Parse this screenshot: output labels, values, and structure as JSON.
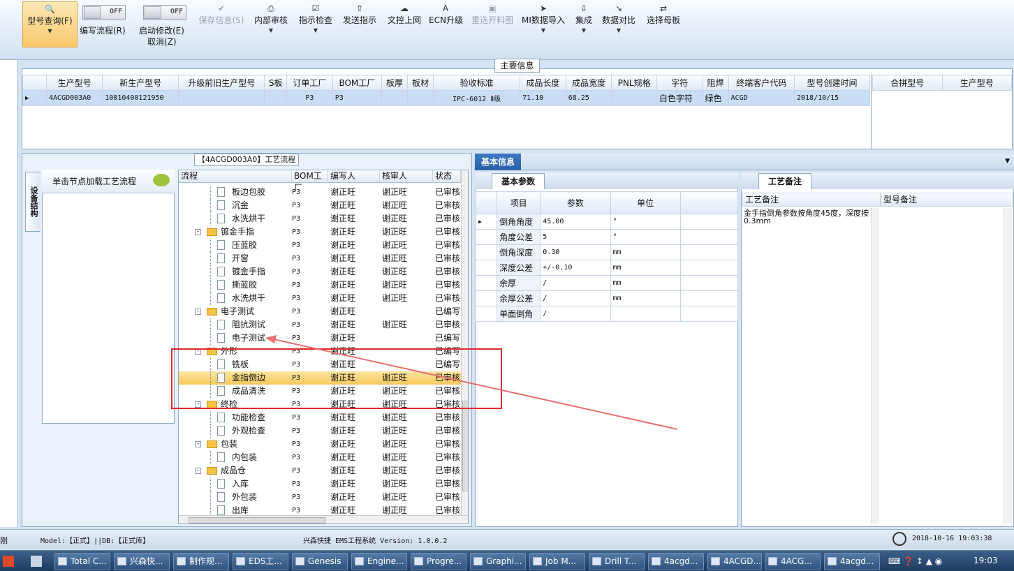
{
  "toolbar": {
    "query": {
      "label": "型号查询(F)",
      "icon": "search-icon"
    },
    "write_flow": {
      "label": "编写流程(R)",
      "toggle": "OFF"
    },
    "start_modify": {
      "label": "启动修改(E)",
      "label2": "取消(Z)",
      "toggle": "OFF"
    },
    "save_info": "保存信息(S)",
    "internal_review": "内部审核",
    "check_instr": "指示检查",
    "send_instr": "发送指示",
    "doc_online": "文控上网",
    "ecn_upgrade": "ECN升级",
    "reopen_drawing": "重选开料图",
    "mi_import": "MI数据导入",
    "integrate": "集成",
    "data_compare": "数据对比",
    "select_master": "选择母板"
  },
  "main_info": {
    "title": "主要信息",
    "headers": [
      "生产型号",
      "新生产型号",
      "升级前旧生产型号",
      "S板",
      "订单工厂",
      "BOM工厂",
      "板厚",
      "板材",
      "验收标准",
      "成品长度",
      "成品宽度",
      "PNL规格",
      "字符",
      "阻焊",
      "终端客户代码",
      "型号创建时间"
    ],
    "row": [
      "4ACGD003A0",
      "10010400121950",
      "",
      "",
      "P3",
      "P3",
      "",
      "",
      "IPC-6012 Ⅱ级",
      "71.10",
      "68.25",
      "",
      "白色字符",
      "绿色",
      "ACGD",
      "2018/10/15"
    ],
    "side_headers": [
      "合拼型号",
      "生产型号"
    ]
  },
  "flow": {
    "title": "【4ACGD003A0】工艺流程",
    "side_tab": "设备结构",
    "hint": "单击节点加载工艺流程",
    "headers": [
      "流程",
      "BOM工厂",
      "编写人",
      "核审人",
      "状态"
    ],
    "rows": [
      {
        "name": "板边包胶",
        "type": "doc",
        "bom": "P3",
        "writer": "谢正旺",
        "reviewer": "谢正旺",
        "status": "已审核"
      },
      {
        "name": "沉金",
        "type": "doc",
        "bom": "P3",
        "writer": "谢正旺",
        "reviewer": "谢正旺",
        "status": "已审核"
      },
      {
        "name": "水洗烘干",
        "type": "doc",
        "bom": "P3",
        "writer": "谢正旺",
        "reviewer": "谢正旺",
        "status": "已审核"
      },
      {
        "name": "镀金手指",
        "type": "folder",
        "bom": "P3",
        "writer": "谢正旺",
        "reviewer": "谢正旺",
        "status": "已审核"
      },
      {
        "name": "压蓝胶",
        "type": "doc",
        "bom": "P3",
        "writer": "谢正旺",
        "reviewer": "谢正旺",
        "status": "已审核"
      },
      {
        "name": "开窗",
        "type": "doc",
        "bom": "P3",
        "writer": "谢正旺",
        "reviewer": "谢正旺",
        "status": "已审核"
      },
      {
        "name": "镀金手指",
        "type": "doc",
        "bom": "P3",
        "writer": "谢正旺",
        "reviewer": "谢正旺",
        "status": "已审核"
      },
      {
        "name": "撕蓝胶",
        "type": "doc",
        "bom": "P3",
        "writer": "谢正旺",
        "reviewer": "谢正旺",
        "status": "已审核"
      },
      {
        "name": "水洗烘干",
        "type": "doc",
        "bom": "P3",
        "writer": "谢正旺",
        "reviewer": "谢正旺",
        "status": "已审核"
      },
      {
        "name": "电子测试",
        "type": "folder",
        "bom": "P3",
        "writer": "谢正旺",
        "reviewer": "",
        "status": "已编写"
      },
      {
        "name": "阻抗测试",
        "type": "doc",
        "bom": "P3",
        "writer": "谢正旺",
        "reviewer": "谢正旺",
        "status": "已审核"
      },
      {
        "name": "电子测试",
        "type": "doc",
        "bom": "P3",
        "writer": "谢正旺",
        "reviewer": "",
        "status": "已编写"
      },
      {
        "name": "外形",
        "type": "folder",
        "bom": "P3",
        "writer": "谢正旺",
        "reviewer": "",
        "status": "已编写"
      },
      {
        "name": "铣板",
        "type": "doc",
        "bom": "P3",
        "writer": "谢正旺",
        "reviewer": "",
        "status": "已编写"
      },
      {
        "name": "金指倒边",
        "type": "doc",
        "bom": "P3",
        "writer": "谢正旺",
        "reviewer": "谢正旺",
        "status": "已审核",
        "selected": true
      },
      {
        "name": "成品清洗",
        "type": "doc",
        "bom": "P3",
        "writer": "谢正旺",
        "reviewer": "谢正旺",
        "status": "已审核"
      },
      {
        "name": "终检",
        "type": "folder",
        "bom": "P3",
        "writer": "谢正旺",
        "reviewer": "谢正旺",
        "status": "已审核"
      },
      {
        "name": "功能检查",
        "type": "doc",
        "bom": "P3",
        "writer": "谢正旺",
        "reviewer": "谢正旺",
        "status": "已审核"
      },
      {
        "name": "外观检查",
        "type": "doc",
        "bom": "P3",
        "writer": "谢正旺",
        "reviewer": "谢正旺",
        "status": "已审核"
      },
      {
        "name": "包装",
        "type": "folder",
        "bom": "P3",
        "writer": "谢正旺",
        "reviewer": "谢正旺",
        "status": "已审核"
      },
      {
        "name": "内包装",
        "type": "doc",
        "bom": "P3",
        "writer": "谢正旺",
        "reviewer": "谢正旺",
        "status": "已审核"
      },
      {
        "name": "成品仓",
        "type": "folder",
        "bom": "P3",
        "writer": "谢正旺",
        "reviewer": "谢正旺",
        "status": "已审核"
      },
      {
        "name": "入库",
        "type": "doc",
        "bom": "P3",
        "writer": "谢正旺",
        "reviewer": "谢正旺",
        "status": "已审核"
      },
      {
        "name": "外包装",
        "type": "doc",
        "bom": "P3",
        "writer": "谢正旺",
        "reviewer": "谢正旺",
        "status": "已审核"
      },
      {
        "name": "出库",
        "type": "doc",
        "bom": "P3",
        "writer": "谢正旺",
        "reviewer": "谢正旺",
        "status": "已审核"
      }
    ]
  },
  "basic_info": {
    "title": "基本信息",
    "tab": "基本参数",
    "headers": [
      "项目",
      "参数",
      "单位"
    ],
    "rows": [
      {
        "item": "倒角角度",
        "param": "45.00",
        "unit": "°"
      },
      {
        "item": "角度公差",
        "param": "5",
        "unit": "°"
      },
      {
        "item": "倒角深度",
        "param": "0.30",
        "unit": "mm"
      },
      {
        "item": "深度公差",
        "param": "+/-0.10",
        "unit": "mm"
      },
      {
        "item": "余厚",
        "param": "/",
        "unit": "mm"
      },
      {
        "item": "余厚公差",
        "param": "/",
        "unit": "mm"
      },
      {
        "item": "单面倒角",
        "param": "/",
        "unit": ""
      }
    ]
  },
  "remark": {
    "tab": "工艺备注",
    "col1": "工艺备注",
    "col2": "型号备注",
    "text": "金手指倒角参数按角度45度，深度按0.3mm"
  },
  "status": {
    "left_char": "刚",
    "model": "Model:【正式】||DB:【正式库】",
    "app": "兴森快捷 EMS工程系统 Version: 1.0.0.2",
    "datetime": "2018-10-16 19:03:38"
  },
  "taskbar": {
    "items": [
      "Total C...",
      "兴森快...",
      "制作规...",
      "EDS工...",
      "Genesis",
      "Engine...",
      "Progre...",
      "Graphi...",
      "Job M...",
      "Drill T...",
      "4acgd...",
      "4ACGD...",
      "4ACG...",
      "4acgd..."
    ],
    "time": "19:03"
  },
  "colors": {
    "accent": "#f6c85c",
    "header_blue": "#2a5fa8",
    "annotation": "#e02a2a"
  }
}
